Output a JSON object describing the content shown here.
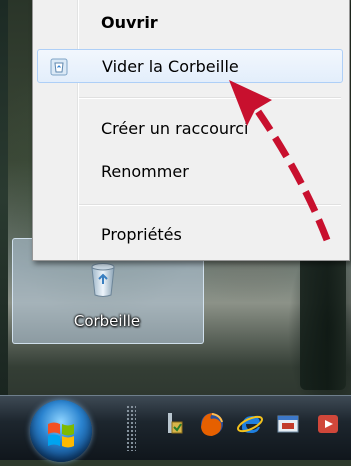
{
  "context_menu": {
    "items": [
      {
        "label": "Ouvrir",
        "bold": true
      },
      {
        "label": "Vider la Corbeille",
        "highlighted": true,
        "icon": "recycle-bin-icon"
      },
      {
        "label": "Créer un raccourci"
      },
      {
        "label": "Renommer"
      },
      {
        "label": "Propriétés"
      }
    ]
  },
  "desktop": {
    "recycle_bin_label": "Corbeille"
  },
  "taskbar": {
    "start_icon": "windows-start-orb",
    "quick_launch": [
      "show-desktop-icon",
      "firefox-icon",
      "internet-explorer-icon",
      "window-switch-icon",
      "media-icon"
    ]
  },
  "colors": {
    "menu_background": "#f0f0f0",
    "highlight_border": "#aecff7",
    "arrow": "#c8102e"
  }
}
